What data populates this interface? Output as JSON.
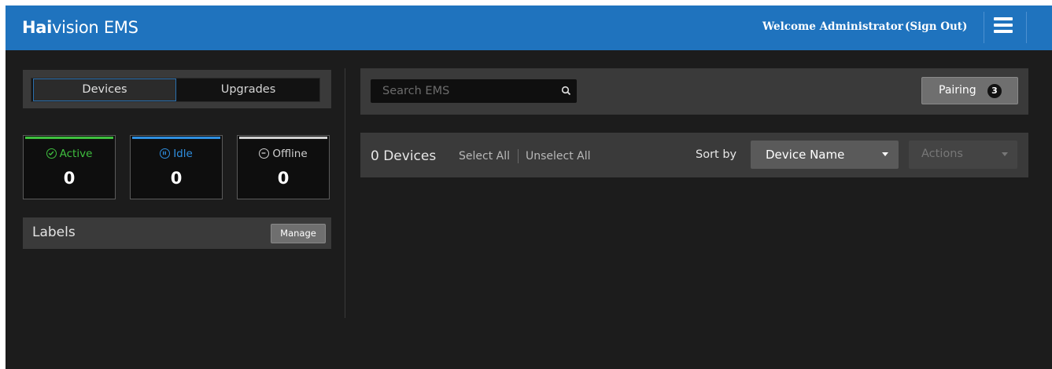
{
  "header": {
    "brand_bold": "Hai",
    "brand_rest": "vision EMS",
    "welcome": "Welcome Administrator",
    "sign_out": "(Sign Out)",
    "accent_color": "#1f73be",
    "menu_icon": "hamburger-menu-icon"
  },
  "tabs": [
    {
      "label": "Devices",
      "active": true
    },
    {
      "label": "Upgrades",
      "active": false
    }
  ],
  "status": [
    {
      "label": "Active",
      "count": "0",
      "color": "#3fbf3f",
      "icon": "check-circle-icon"
    },
    {
      "label": "Idle",
      "count": "0",
      "color": "#2f8fe0",
      "icon": "pause-circle-icon"
    },
    {
      "label": "Offline",
      "count": "0",
      "color": "#cfcfcf",
      "icon": "minus-circle-icon"
    }
  ],
  "labels": {
    "title": "Labels",
    "manage_label": "Manage"
  },
  "search": {
    "placeholder": "Search EMS",
    "value": ""
  },
  "pairing": {
    "label": "Pairing",
    "badge": "3"
  },
  "devices": {
    "count_label": "0 Devices",
    "select_all": "Select All",
    "unselect_all": "Unselect All",
    "sort_by_label": "Sort by",
    "sort_value": "Device Name",
    "actions_label": "Actions"
  }
}
